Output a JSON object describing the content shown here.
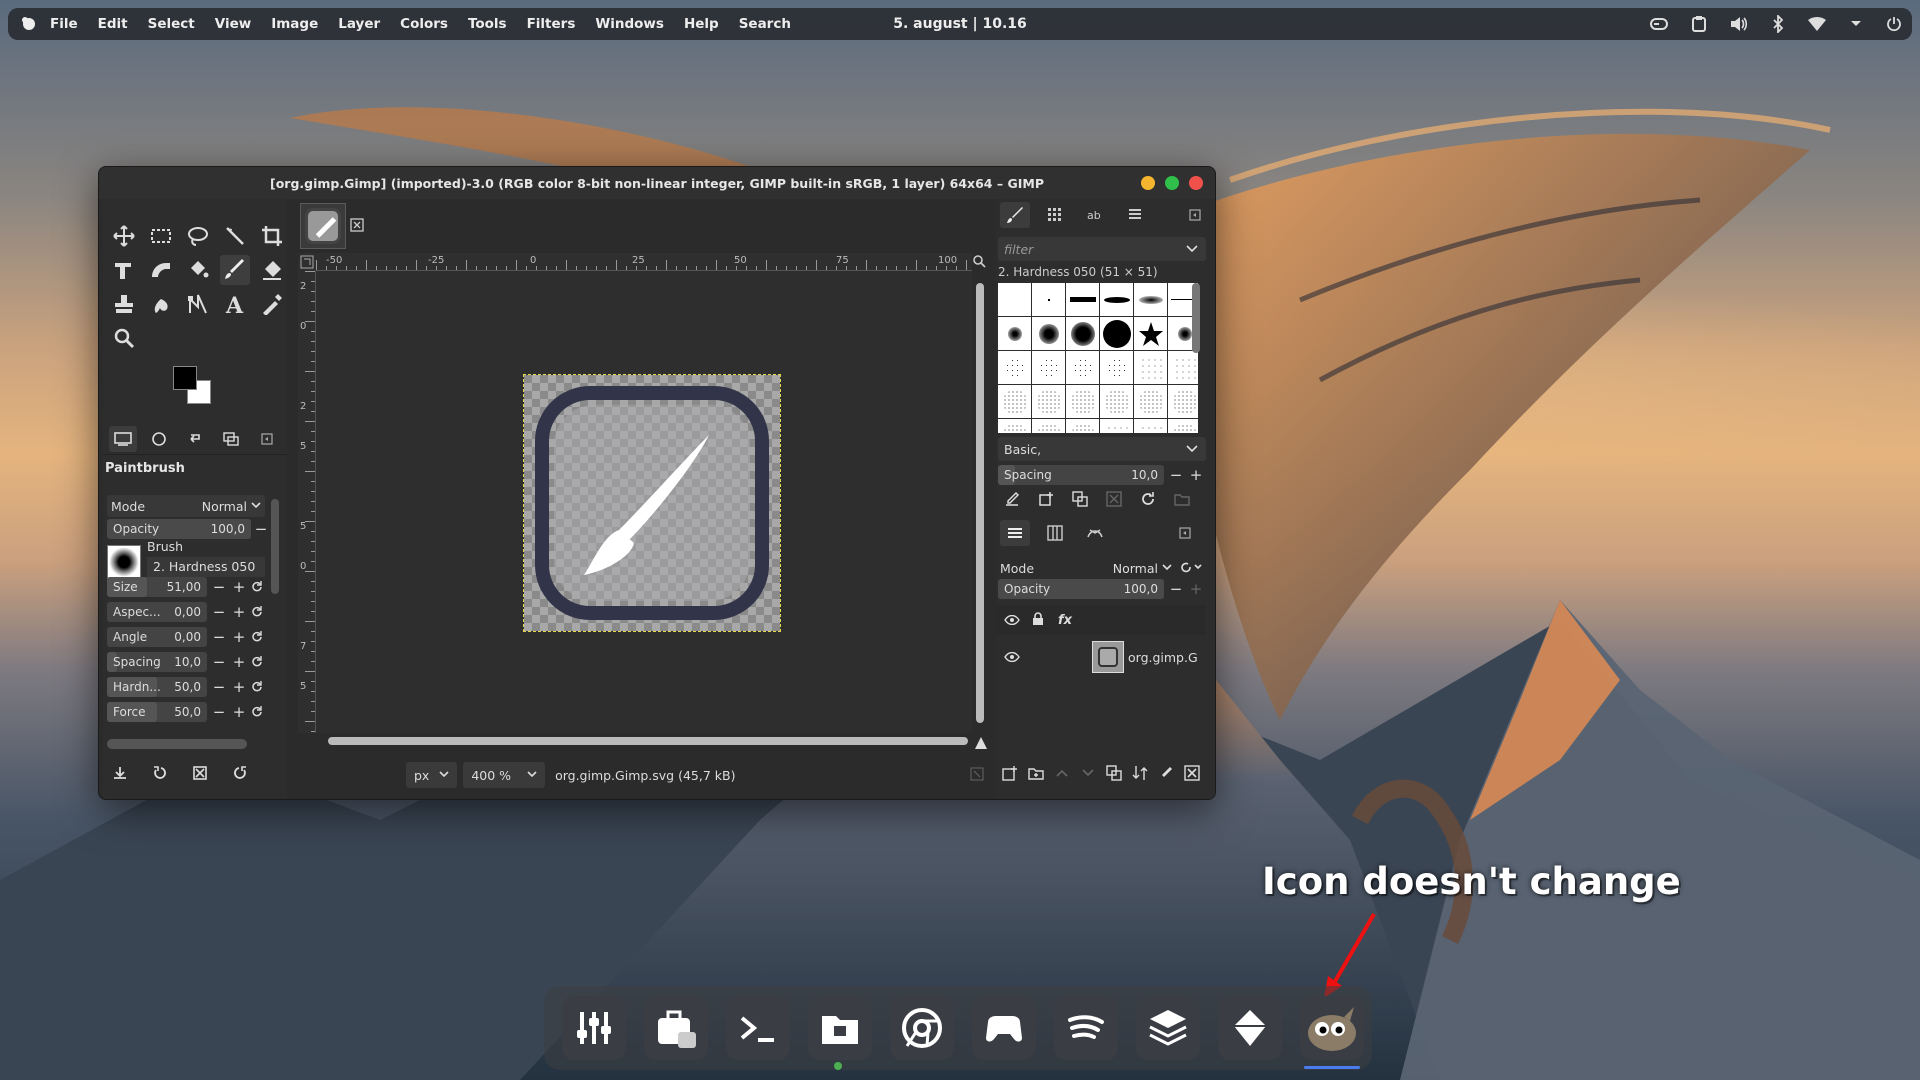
{
  "topbar": {
    "menus": [
      "File",
      "Edit",
      "Select",
      "View",
      "Image",
      "Layer",
      "Colors",
      "Tools",
      "Filters",
      "Windows",
      "Help",
      "Search"
    ],
    "clock": "5. august | 10.16",
    "tray_icons": [
      "gamepad-icon",
      "clipboard-icon",
      "volume-icon",
      "bluetooth-icon",
      "wifi-icon",
      "chevron-down-icon",
      "power-icon"
    ]
  },
  "window": {
    "title": "[org.gimp.Gimp] (imported)-3.0 (RGB color 8-bit non-linear integer, GIMP built-in sRGB, 1 layer) 64x64 – GIMP",
    "buttons_colors": {
      "minimize": "#f5b52e",
      "maximize": "#2fbf4a",
      "close": "#f0524b"
    }
  },
  "tool_options": {
    "title": "Paintbrush",
    "mode_label": "Mode",
    "mode_value": "Normal",
    "opacity_label": "Opacity",
    "opacity_value": "100,0",
    "brush_label": "Brush",
    "brush_value": "2. Hardness 050",
    "sliders": [
      {
        "label": "Size",
        "value": "51,00"
      },
      {
        "label": "Aspec...",
        "value": "0,00"
      },
      {
        "label": "Angle",
        "value": "0,00"
      },
      {
        "label": "Spacing",
        "value": "10,0"
      },
      {
        "label": "Hardn...",
        "value": "50,0"
      },
      {
        "label": "Force",
        "value": "50,0"
      }
    ]
  },
  "rulers": {
    "h_ticks": [
      "-50",
      "-25",
      "0",
      "25",
      "50",
      "75",
      "100"
    ],
    "v_ticks": [
      "2",
      "0",
      "2",
      "5",
      "5",
      "0",
      "7",
      "5"
    ]
  },
  "statusbar": {
    "unit": "px",
    "zoom": "400 %",
    "filename": "org.gimp.Gimp.svg (45,7 kB)"
  },
  "brushes": {
    "filter_placeholder": "filter",
    "selected": "2. Hardness 050 (51 × 51)",
    "preset": "Basic,",
    "spacing_label": "Spacing",
    "spacing_value": "10,0"
  },
  "layers": {
    "mode_label": "Mode",
    "mode_value": "Normal",
    "opacity_label": "Opacity",
    "opacity_value": "100,0",
    "fx_label": "fx",
    "layer_name": "org.gimp.G"
  },
  "annotation": "Icon doesn't change",
  "dock_apps": [
    "mixer-icon",
    "software-store-icon",
    "terminal-icon",
    "files-icon",
    "chrome-icon",
    "games-icon",
    "spotify-icon",
    "stack-icon",
    "installer-icon",
    "gimp-icon"
  ]
}
